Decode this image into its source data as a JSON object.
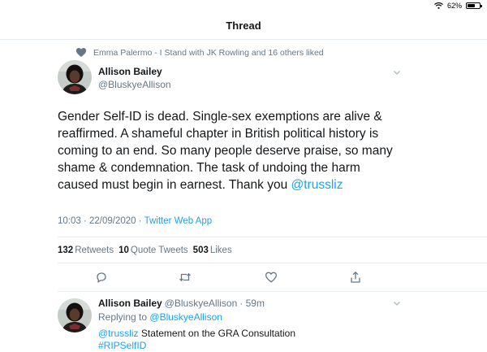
{
  "status_bar": {
    "battery_text": "62%",
    "battery_level": 0.62,
    "icons": [
      "wifi-icon",
      "battery-icon"
    ]
  },
  "header": {
    "title": "Thread"
  },
  "social_context": {
    "text": "Emma Palermo - I Stand with JK Rowling and 16 others liked",
    "icon": "heart-icon"
  },
  "tweet": {
    "author_name": "Allison Bailey",
    "author_handle": "@BluskyeAllison",
    "text": "Gender Self-ID is dead. Single-sex exemptions are alive & reaffirmed. A shameful chapter in British political history is coming to an end. So many people deserve praise, so many shame & condemnation. The task of undoing the harm caused must begin in earnest. Thank you",
    "mention": "@trussliz",
    "time": "10:03 · 22/09/2020 ·",
    "client": "Twitter Web App",
    "stats": {
      "retweets_count": "132",
      "retweets_label": "Retweets",
      "quotes_count": "10",
      "quotes_label": "Quote Tweets",
      "likes_count": "503",
      "likes_label": "Likes"
    },
    "actions": [
      "reply-icon",
      "retweet-icon",
      "like-icon",
      "share-icon"
    ]
  },
  "reply": {
    "author_name": "Allison Bailey",
    "author_handle": "@BluskyeAllison",
    "time": "· 59m",
    "replying_prefix": "Replying to",
    "replying_to": "@BluskyeAllison",
    "mention": "@trussliz",
    "text": "Statement on the GRA Consultation",
    "hashtag": "#RIPSelfID"
  },
  "colors": {
    "accent": "#1da1f2",
    "muted": "#657786",
    "text": "#14171a",
    "divider": "#e6ecf0"
  }
}
